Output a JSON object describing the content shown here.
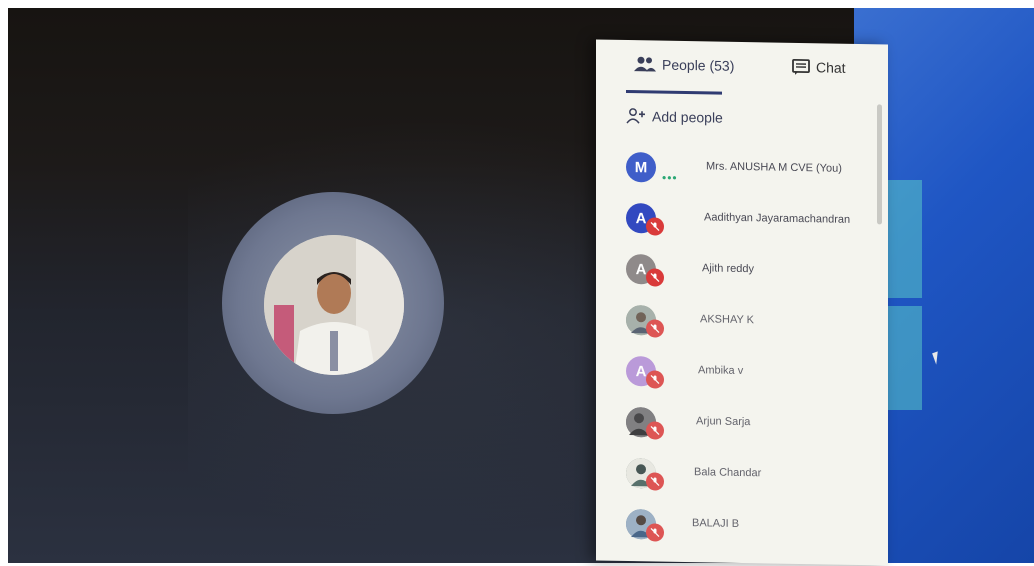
{
  "panel": {
    "tabs": [
      {
        "label": "People (53)",
        "icon": "people-icon"
      },
      {
        "label": "Chat",
        "icon": "chat-icon"
      }
    ],
    "add_people_label": "Add people"
  },
  "participants": [
    {
      "name": "Mrs. ANUSHA M CVE (You)",
      "initial": "M",
      "avatar_color": "#3f5ec9",
      "muted": false,
      "speaking": true
    },
    {
      "name": "Aadithyan Jayaramachandran",
      "initial": "A",
      "avatar_color": "#3249c0",
      "muted": true
    },
    {
      "name": "Ajith reddy",
      "initial": "A",
      "avatar_color": "#8f8a8a",
      "muted": true
    },
    {
      "name": "AKSHAY K",
      "initial": "",
      "avatar_color": "#7e8f7a",
      "muted": true
    },
    {
      "name": "Ambika v",
      "initial": "A",
      "avatar_color": "#b18bd6",
      "muted": true
    },
    {
      "name": "Arjun Sarja",
      "initial": "",
      "avatar_color": "#4b4a4f",
      "muted": true
    },
    {
      "name": "Bala Chandar",
      "initial": "",
      "avatar_color": "#5f6f6b",
      "muted": true
    },
    {
      "name": "BALAJI B",
      "initial": "",
      "avatar_color": "#4d6d8c",
      "muted": true
    }
  ],
  "colors": {
    "muted_badge": "#d93a3a",
    "desktop": "#1f56c4",
    "panel_bg": "#f4f4ee"
  }
}
